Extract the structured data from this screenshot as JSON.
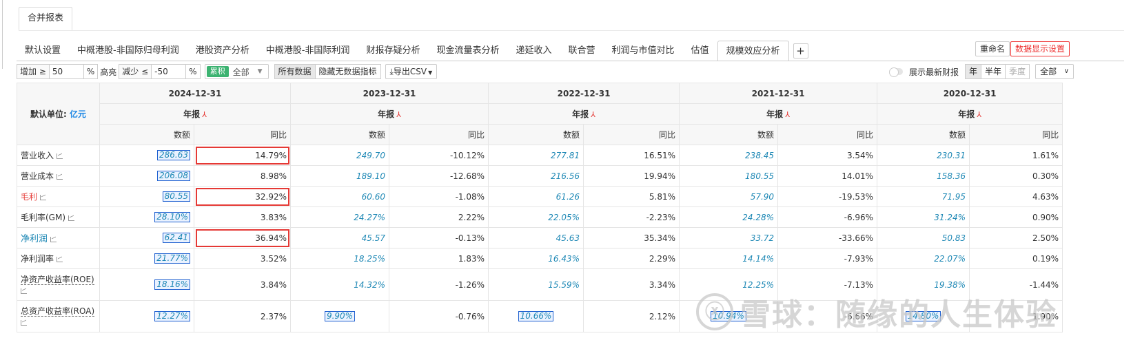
{
  "top_tab": "合并报表",
  "sub_tabs": [
    "默认设置",
    "中概港股-非国际归母利润",
    "港股资产分析",
    "中概港股-非国际利润",
    "财报存疑分析",
    "现金流量表分析",
    "递延收入",
    "联合营",
    "利润与市值对比",
    "估值",
    "规模效应分析"
  ],
  "plus_label": "+",
  "rename_btn": "重命名",
  "display_settings_btn": "数据显示设置",
  "toolbar": {
    "increase_label": "增加 ≥",
    "increase_value": "50",
    "pct1": "%",
    "highlight_label": "高亮",
    "decrease_label": "减少 ≤",
    "decrease_value": "-50",
    "pct2": "%",
    "cumulative": "累积",
    "all": "全部",
    "all_data": "所有数据",
    "hide_empty": "隐藏无数据指标",
    "export_csv": "导出CSV"
  },
  "right_tools": {
    "show_latest": "展示最新财报",
    "year": "年",
    "half_year": "半年",
    "quarter": "季度",
    "all_select": "全部"
  },
  "table": {
    "unit_label": "默认单位:",
    "unit_value": "亿元",
    "periods": [
      {
        "date": "2024-12-31",
        "report": "年报"
      },
      {
        "date": "2023-12-31",
        "report": "年报"
      },
      {
        "date": "2022-12-31",
        "report": "年报"
      },
      {
        "date": "2021-12-31",
        "report": "年报"
      },
      {
        "date": "2020-12-31",
        "report": "年报"
      }
    ],
    "col_amount": "数额",
    "col_yoy": "同比",
    "rows": [
      {
        "name": "营业收入",
        "values": [
          "286.63",
          "14.79%",
          "249.70",
          "-10.12%",
          "277.81",
          "16.51%",
          "238.45",
          "3.54%",
          "230.31",
          "1.61%"
        ]
      },
      {
        "name": "营业成本",
        "values": [
          "206.08",
          "8.98%",
          "189.10",
          "-12.68%",
          "216.56",
          "19.94%",
          "180.55",
          "14.01%",
          "158.36",
          "0.30%"
        ]
      },
      {
        "name": "毛利",
        "values": [
          "80.55",
          "32.92%",
          "60.60",
          "-1.08%",
          "61.26",
          "5.81%",
          "57.90",
          "-19.53%",
          "71.95",
          "4.63%"
        ]
      },
      {
        "name": "毛利率(GM)",
        "values": [
          "28.10%",
          "3.83%",
          "24.27%",
          "2.22%",
          "22.05%",
          "-2.23%",
          "24.28%",
          "-6.96%",
          "31.24%",
          "0.90%"
        ]
      },
      {
        "name": "净利润",
        "values": [
          "62.41",
          "36.94%",
          "45.57",
          "-0.13%",
          "45.63",
          "35.34%",
          "33.72",
          "-33.66%",
          "50.83",
          "2.50%"
        ]
      },
      {
        "name": "净利润率",
        "values": [
          "21.77%",
          "3.52%",
          "18.25%",
          "1.83%",
          "16.43%",
          "2.29%",
          "14.14%",
          "-7.93%",
          "22.07%",
          "0.19%"
        ]
      },
      {
        "name": "净资产收益率(ROE)",
        "values": [
          "18.16%",
          "3.84%",
          "14.32%",
          "-1.26%",
          "15.59%",
          "3.34%",
          "12.25%",
          "-7.13%",
          "19.38%",
          "-1.44%"
        ]
      },
      {
        "name": "总资产收益率(ROA)",
        "values": [
          "12.27%",
          "2.37%",
          "9.90%",
          "-0.76%",
          "10.66%",
          "2.12%",
          "10.94%",
          "-6.66%",
          "14.80%",
          "1.90%"
        ]
      }
    ]
  },
  "watermark": {
    "logo": "ⓧ",
    "text": "雪球：随缘的人生体验"
  }
}
